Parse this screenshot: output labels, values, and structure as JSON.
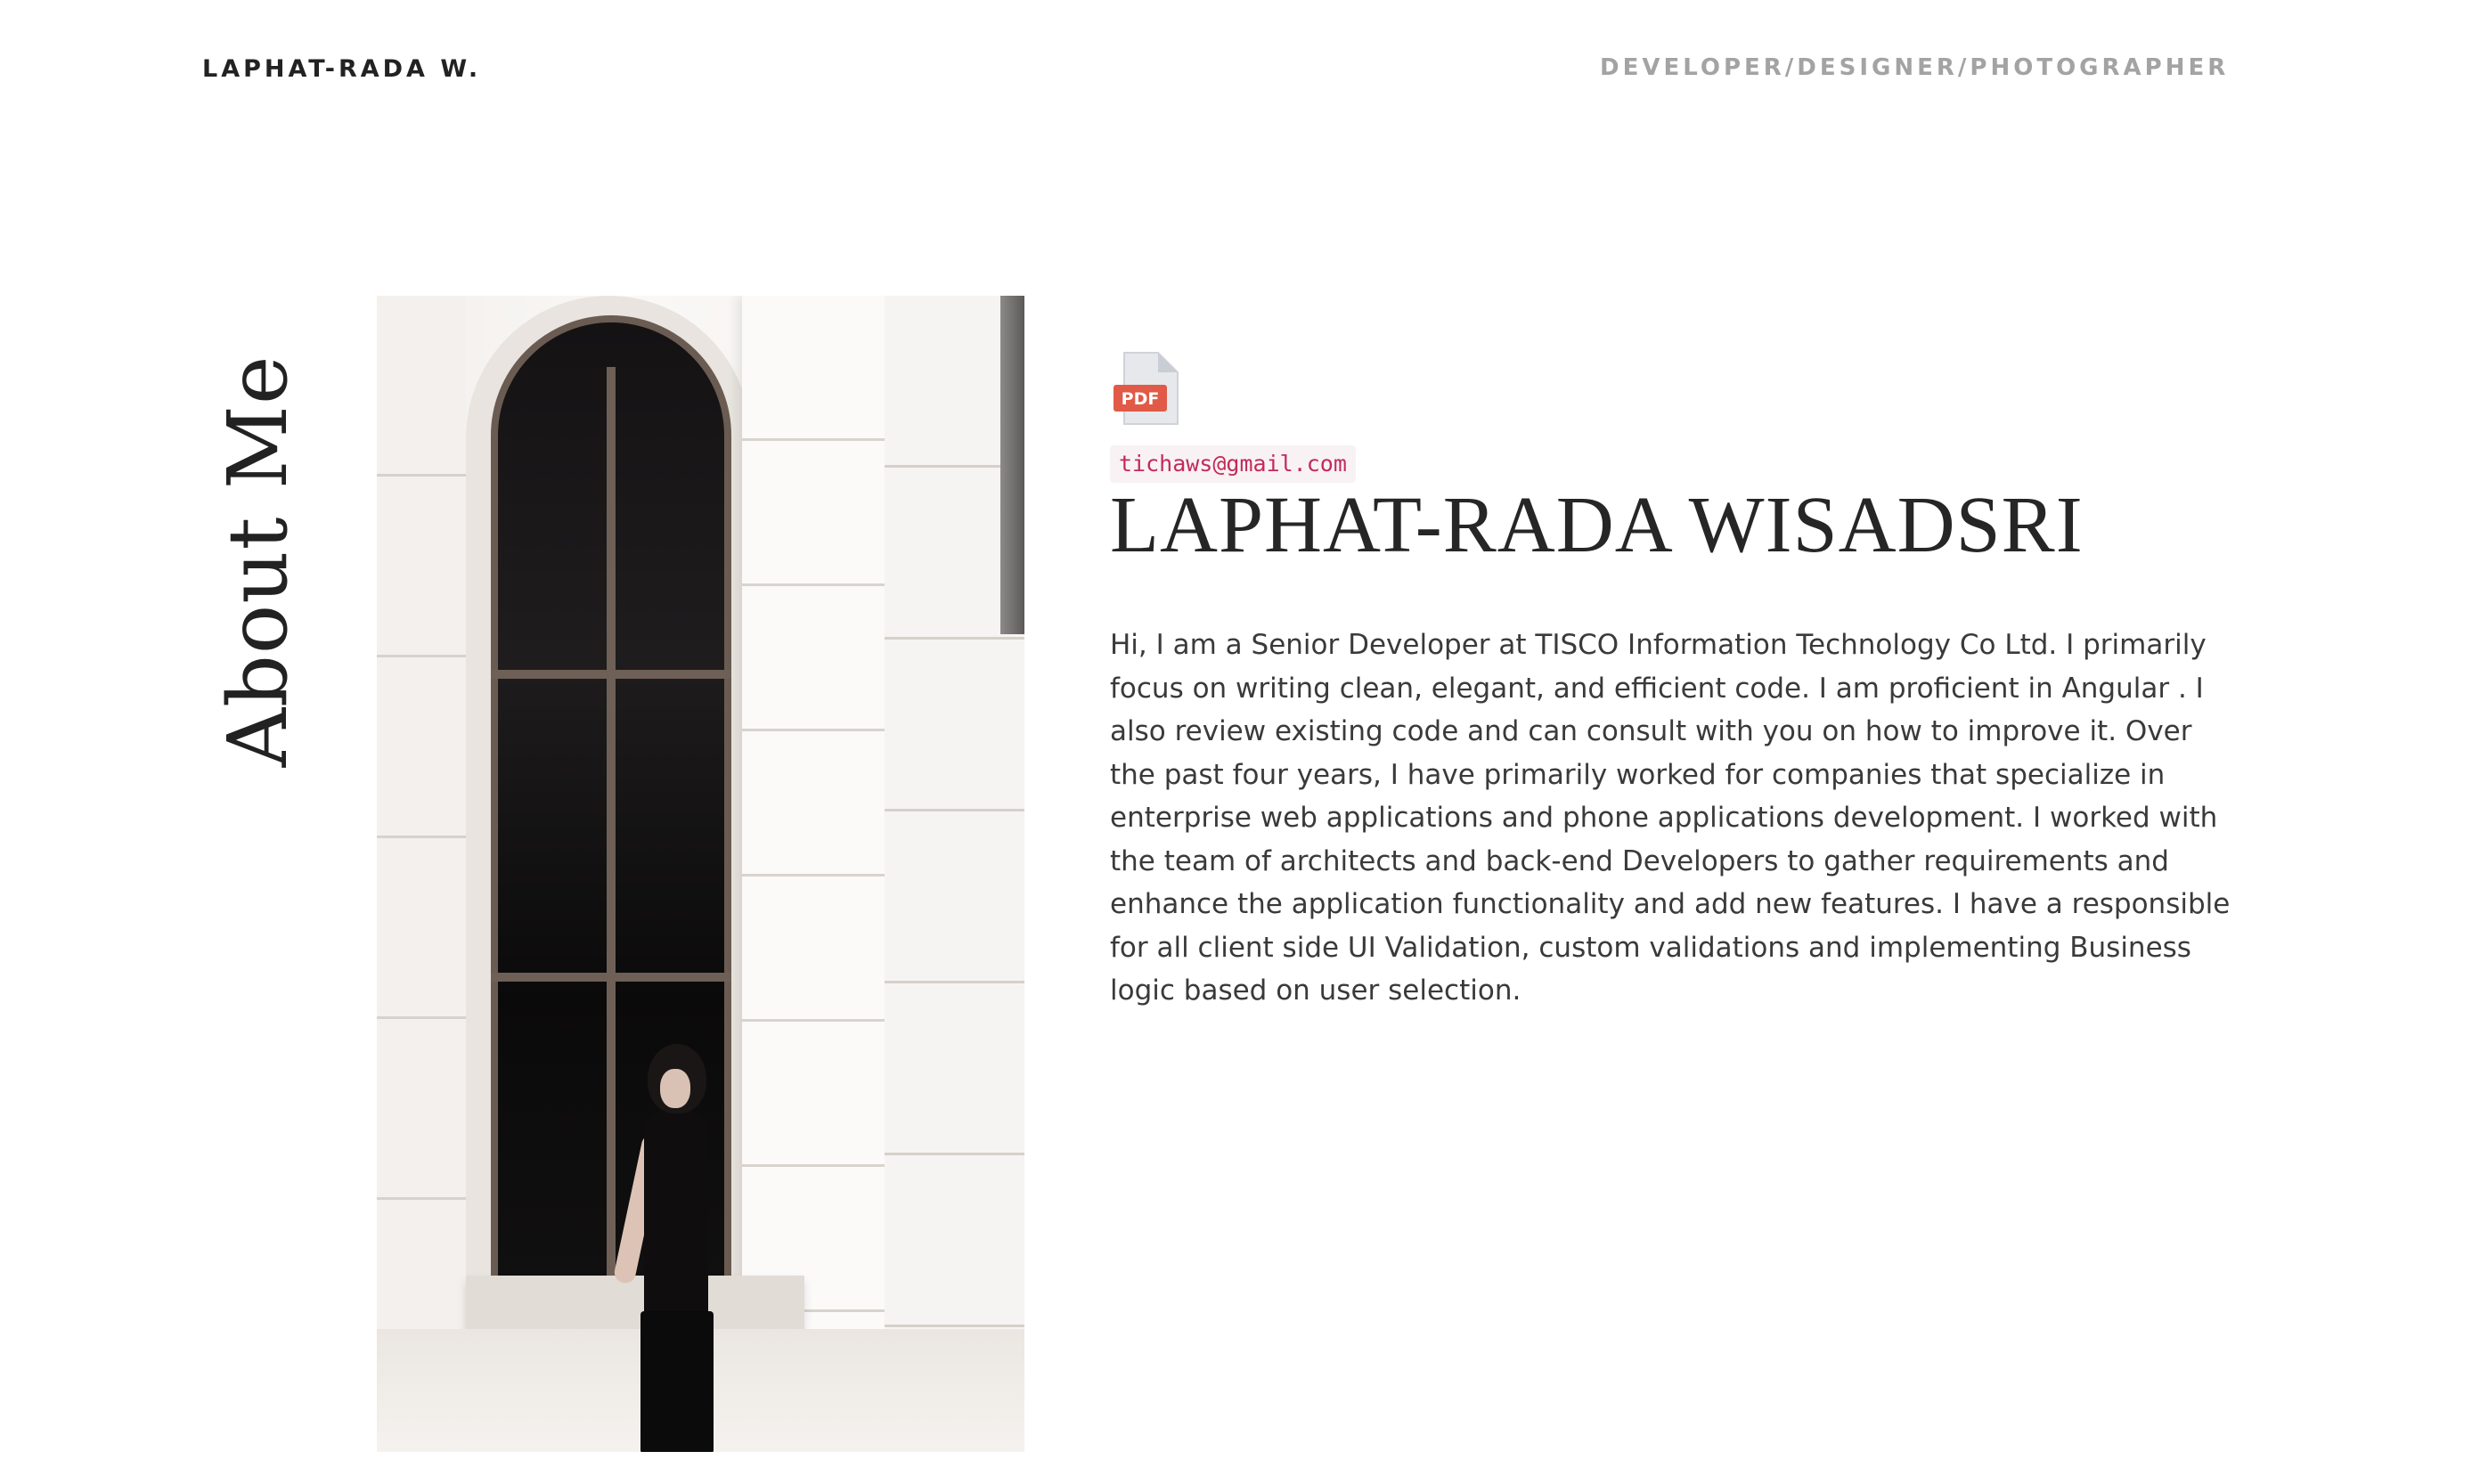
{
  "header": {
    "brand": "LAPHAT-RADA W.",
    "tagline": "DEVELOPER/DESIGNER/PHOTOGRAPHER"
  },
  "section": {
    "heading": "About Me"
  },
  "profile": {
    "photo_icon": "portrait-photo",
    "resume_icon": "pdf-file-icon",
    "resume_badge": "PDF",
    "email": "tichaws@gmail.com",
    "name": "LAPHAT-RADA WISADSRI",
    "bio": "Hi, I am a Senior Developer at TISCO Information Technology Co Ltd. I primarily focus on writing clean, elegant, and efficient code. I am proficient in Angular . I also review existing code and can consult with you on how to improve it. Over the past four years, I have primarily worked for companies that specialize in enterprise web applications and phone applications development. I worked with the team of architects and back-end Developers to gather requirements and enhance the application functionality and add new features. I have a responsible for all client side UI Validation, custom validations and implementing Business logic based on user selection."
  },
  "colors": {
    "text": "#262626",
    "tagline": "#a3a3a3",
    "email": "#c32a5a",
    "email_bg": "#f8f2f4",
    "pdf_badge": "#e05a47"
  }
}
